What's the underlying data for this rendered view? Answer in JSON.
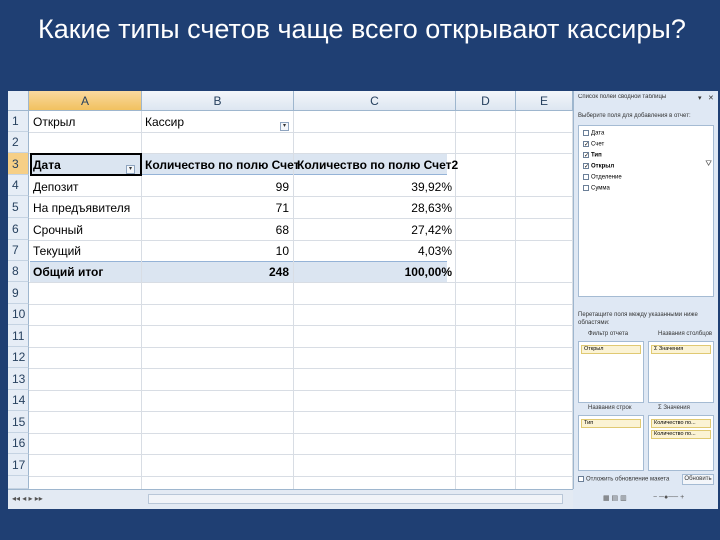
{
  "slide": {
    "title": "Какие типы счетов чаще всего открывают кассиры?"
  },
  "grid": {
    "columns": [
      "A",
      "B",
      "C",
      "D",
      "E"
    ],
    "rows": [
      "1",
      "2",
      "3",
      "4",
      "5",
      "6",
      "7",
      "8",
      "9",
      "10",
      "11",
      "12",
      "13",
      "14",
      "15",
      "16",
      "17"
    ],
    "filter": {
      "label": "Открыл",
      "value": "Кассир"
    },
    "pivot": {
      "headers": [
        "Дата",
        "Количество по полю Счет",
        "Количество по полю Счет2"
      ],
      "rows": [
        {
          "label": "Депозит",
          "count": "99",
          "pct": "39,92%"
        },
        {
          "label": "На предъявителя",
          "count": "71",
          "pct": "28,63%"
        },
        {
          "label": "Срочный",
          "count": "68",
          "pct": "27,42%"
        },
        {
          "label": "Текущий",
          "count": "10",
          "pct": "4,03%"
        }
      ],
      "total": {
        "label": "Общий итог",
        "count": "248",
        "pct": "100,00%"
      }
    }
  },
  "pane": {
    "title": "Список полей сводной таблицы",
    "choose_label": "Выберите поля для добавления в отчет:",
    "fields": [
      {
        "label": "Дата",
        "checked": false
      },
      {
        "label": "Счет",
        "checked": true
      },
      {
        "label": "Тип",
        "checked": true
      },
      {
        "label": "Открыл",
        "checked": true
      },
      {
        "label": "Отделение",
        "checked": false
      },
      {
        "label": "Сумма",
        "checked": false
      }
    ],
    "drag_label": "Перетащите поля между указанными ниже областями:",
    "areas": {
      "filter": {
        "title": "Фильтр отчета",
        "chips": [
          "Открыл"
        ]
      },
      "columns": {
        "title": "Названия столбцов",
        "chips": [
          "Σ Значения"
        ]
      },
      "rows": {
        "title": "Названия строк",
        "chips": [
          "Тип"
        ]
      },
      "values": {
        "title": "Σ Значения",
        "chips": [
          "Количество по...",
          "Количество по..."
        ]
      }
    },
    "defer_label": "Отложить обновление макета",
    "update_label": "Обновить"
  }
}
